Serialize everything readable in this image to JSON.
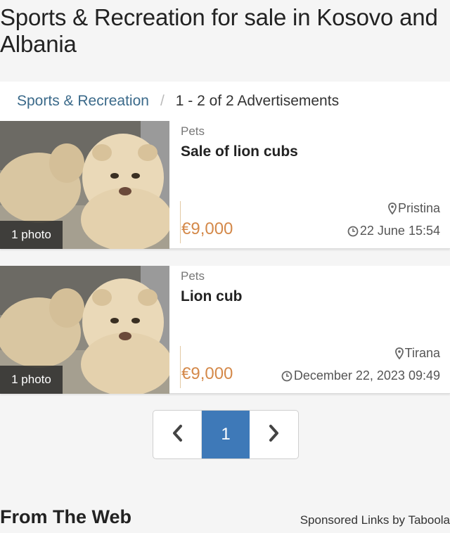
{
  "page": {
    "title": "Sports & Recreation for sale in Kosovo and Albania"
  },
  "breadcrumb": {
    "category": "Sports & Recreation",
    "separator": "/",
    "count": "1 - 2 of 2 Advertisements"
  },
  "listings": [
    {
      "category": "Pets",
      "title": "Sale of lion cubs",
      "photo_badge": "1 photo",
      "price": "€9,000",
      "location": "Pristina",
      "date": "22 June 15:54"
    },
    {
      "category": "Pets",
      "title": "Lion cub",
      "photo_badge": "1 photo",
      "price": "€9,000",
      "location": "Tirana",
      "date": "December 22, 2023 09:49"
    }
  ],
  "pagination": {
    "current_page": "1",
    "prev_icon": "chevron-left-icon",
    "next_icon": "chevron-right-icon"
  },
  "footer": {
    "from_web": "From The Web",
    "sponsored": "Sponsored Links by Taboola"
  },
  "colors": {
    "accent_price": "#d4894a",
    "breadcrumb_link": "#3b6a8a",
    "pager_active": "#3e79b8"
  }
}
